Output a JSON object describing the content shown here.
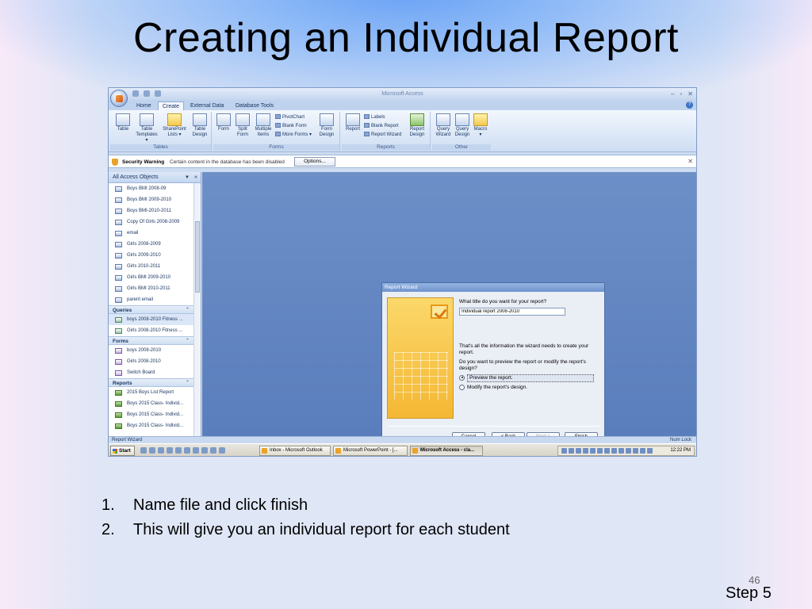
{
  "slide": {
    "title": "Creating an Individual Report",
    "bullets": [
      {
        "num": "1.",
        "text": "Name file and click finish"
      },
      {
        "num": "2.",
        "text": "This will give you an individual report for each student"
      }
    ],
    "slide_number": "46",
    "step": "Step 5"
  },
  "app": {
    "window_title": "Microsoft Access",
    "tabs": [
      "Home",
      "Create",
      "External Data",
      "Database Tools"
    ],
    "active_tab": "Create",
    "ribbon": {
      "tables": {
        "label": "Tables",
        "buttons": [
          {
            "line1": "Table",
            "line2": ""
          },
          {
            "line1": "Table",
            "line2": "Templates ▾"
          },
          {
            "line1": "SharePoint",
            "line2": "Lists ▾"
          },
          {
            "line1": "Table",
            "line2": "Design"
          }
        ]
      },
      "forms": {
        "label": "Forms",
        "buttons": [
          {
            "line1": "Form",
            "line2": ""
          },
          {
            "line1": "Split",
            "line2": "Form"
          },
          {
            "line1": "Multiple",
            "line2": "Items"
          }
        ],
        "small": [
          "PivotChart",
          "Blank Form",
          "More Forms ▾"
        ],
        "design": {
          "line1": "Form",
          "line2": "Design"
        }
      },
      "reports": {
        "label": "Reports",
        "report": "Report",
        "small": [
          "Labels",
          "Blank Report",
          "Report Wizard"
        ],
        "design": {
          "line1": "Report",
          "line2": "Design"
        }
      },
      "other": {
        "label": "Other",
        "buttons": [
          {
            "line1": "Query",
            "line2": "Wizard"
          },
          {
            "line1": "Query",
            "line2": "Design"
          },
          {
            "line1": "Macro",
            "line2": "▾"
          }
        ]
      }
    },
    "security": {
      "title": "Security Warning",
      "message": "Certain content in the database has been disabled",
      "options_label": "Options..."
    },
    "nav": {
      "header": "All Access Objects",
      "tables": [
        "Boys BMI 2008-09",
        "Boys BMI 2009-2010",
        "Boys BMI-2010-2011",
        "Copy Of Girls 2008-2009",
        "email",
        "Girls 2008-2009",
        "Girls 2009-2010",
        "Girls 2010-2011",
        "Girls BMI 2009-2010",
        "Girls BMI 2010-2011",
        "parent email"
      ],
      "queries_label": "Queries",
      "queries": [
        "boys 2008-2010 Fitness ...",
        "Girls 2008-2010 Fitness ..."
      ],
      "forms_label": "Forms",
      "forms": [
        "boys 2008-2010",
        "Girls 2008-2010",
        "Switch Board"
      ],
      "reports_label": "Reports",
      "reports": [
        "2015 Boys List Report",
        "Boys 2015 Class- Individ...",
        "Boys 2015 Class- Individ...",
        "Boys 2015 Class- Individ..."
      ]
    },
    "wizard": {
      "title": "Report Wizard",
      "question": "What title do you want for your report?",
      "report_title_value": "Individual report 2008-2010",
      "info": "That's all the information the wizard needs to create your report.",
      "preview_question": "Do you want to preview the report or modify the report's design?",
      "option_preview": "Preview the report.",
      "option_modify": "Modify the report's design.",
      "cancel": "Cancel",
      "back": "< Back",
      "next": "Next >",
      "finish": "Finish"
    },
    "status": {
      "left": "Report Wizard",
      "right": "Num Lock"
    },
    "taskbar": {
      "start": "Start",
      "items": [
        "Inbox - Microsoft Outlook",
        "Microsoft PowerPoint - [...",
        "Microsoft Access - cla..."
      ],
      "clock": "12:22 PM"
    }
  }
}
